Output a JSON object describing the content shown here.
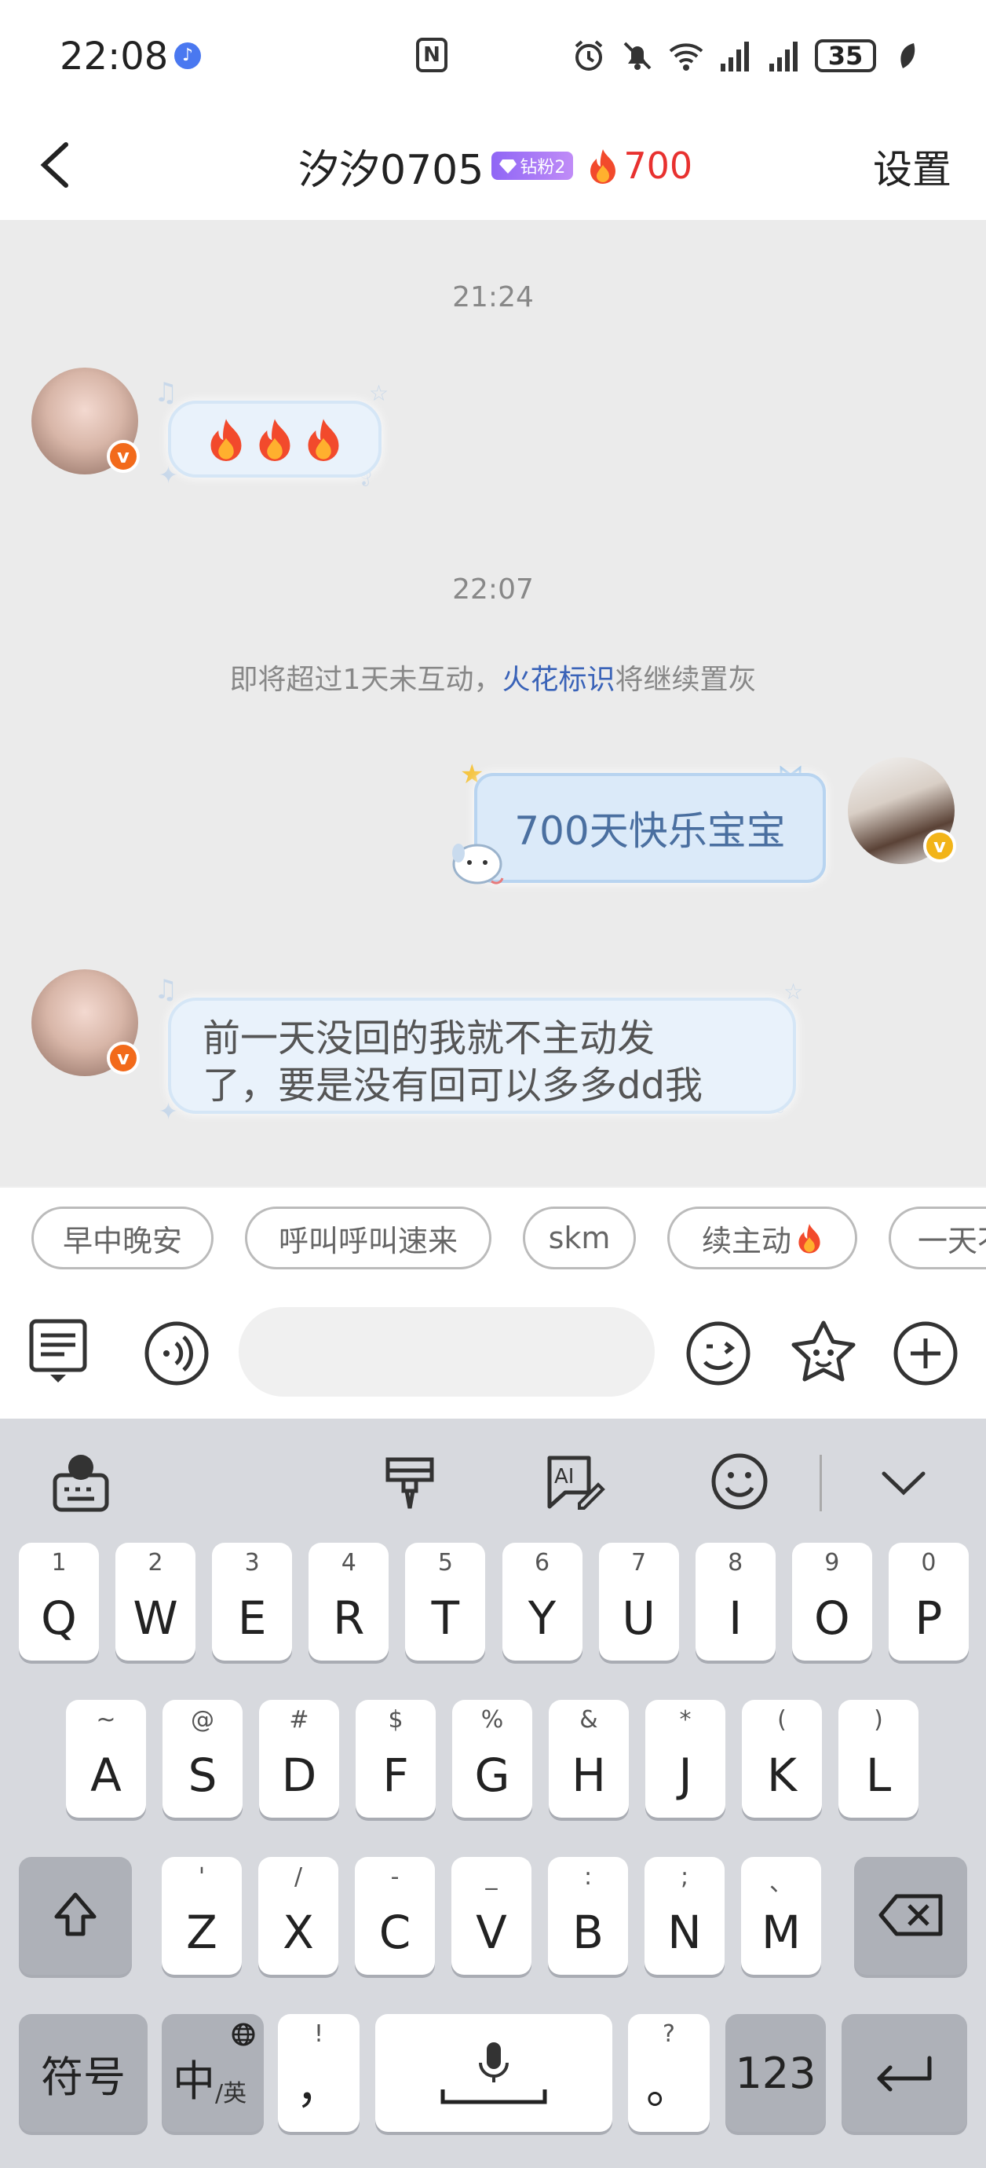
{
  "status_bar": {
    "time": "22:08",
    "battery": "35",
    "nfc": "N"
  },
  "header": {
    "contact_name": "汐汐0705",
    "fan_badge": "钻粉2",
    "spark_count": "700",
    "settings_label": "设置"
  },
  "chat": {
    "timestamp_1": "21:24",
    "fires_emoji": "🔥",
    "timestamp_2": "22:07",
    "notice_prefix": "即将超过1天未互动，",
    "notice_link": "火花标识",
    "notice_suffix": "将继续置灰",
    "my_message": "700天快乐宝宝",
    "their_message_line1": "前一天没回的我就不主动发",
    "their_message_line2": "了，要是没有回可以多多dd我"
  },
  "quick_replies": [
    "早中晚安",
    "呼叫呼叫速来",
    "skm",
    "续主动",
    "一天不"
  ],
  "input": {
    "placeholder": ""
  },
  "keyboard": {
    "row1": [
      {
        "main": "Q",
        "sub": "1"
      },
      {
        "main": "W",
        "sub": "2"
      },
      {
        "main": "E",
        "sub": "3"
      },
      {
        "main": "R",
        "sub": "4"
      },
      {
        "main": "T",
        "sub": "5"
      },
      {
        "main": "Y",
        "sub": "6"
      },
      {
        "main": "U",
        "sub": "7"
      },
      {
        "main": "I",
        "sub": "8"
      },
      {
        "main": "O",
        "sub": "9"
      },
      {
        "main": "P",
        "sub": "0"
      }
    ],
    "row2": [
      {
        "main": "A",
        "sub": "~"
      },
      {
        "main": "S",
        "sub": "@"
      },
      {
        "main": "D",
        "sub": "#"
      },
      {
        "main": "F",
        "sub": "$"
      },
      {
        "main": "G",
        "sub": "%"
      },
      {
        "main": "H",
        "sub": "&"
      },
      {
        "main": "J",
        "sub": "*"
      },
      {
        "main": "K",
        "sub": "("
      },
      {
        "main": "L",
        "sub": ")"
      }
    ],
    "row3": [
      {
        "main": "Z",
        "sub": "'"
      },
      {
        "main": "X",
        "sub": "/"
      },
      {
        "main": "C",
        "sub": "-"
      },
      {
        "main": "V",
        "sub": "_"
      },
      {
        "main": "B",
        "sub": ":"
      },
      {
        "main": "N",
        "sub": ";"
      },
      {
        "main": "M",
        "sub": "、"
      }
    ],
    "symbols_label": "符号",
    "lang_main": "中",
    "lang_sub": "/英",
    "comma_main": "，",
    "comma_sub": "!",
    "period_main": "。",
    "period_sub": "?",
    "num_label": "123"
  },
  "colors": {
    "spark_red": "#e8312f",
    "link_blue": "#3a63b8",
    "badge_purple": "#8f66f5",
    "verified_orange": "#f26a1b",
    "verified_gold": "#f2b418"
  }
}
